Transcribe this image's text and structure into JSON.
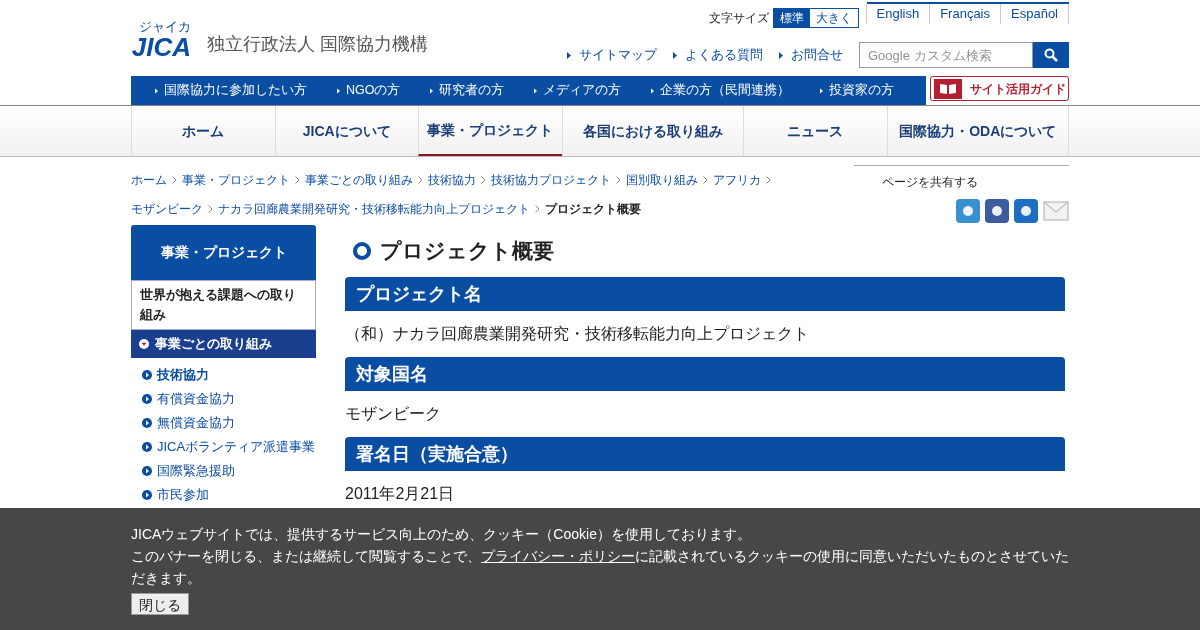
{
  "header": {
    "org_name": "独立行政法人 国際協力機構",
    "logo_text": "JICA",
    "logo_sub": "ジャイカ",
    "font_size": {
      "label": "文字サイズ",
      "options": [
        {
          "label": "標準",
          "selected": true
        },
        {
          "label": "大きく",
          "selected": false
        }
      ]
    },
    "languages": [
      "English",
      "Français",
      "Español"
    ],
    "links": [
      "サイトマップ",
      "よくある質問",
      "お問合せ"
    ],
    "search": {
      "placeholder": "Google カスタム検索"
    }
  },
  "audience_bar": {
    "links": [
      "国際協力に参加したい方",
      "NGOの方",
      "研究者の方",
      "メディアの方",
      "企業の方（民間連携）",
      "投資家の方"
    ],
    "guide": "サイト活用ガイド"
  },
  "nav": [
    {
      "label": "ホーム",
      "selected": false
    },
    {
      "label": "JICAについて",
      "selected": false
    },
    {
      "label": "事業・プロジェクト",
      "selected": true
    },
    {
      "label": "各国における取り組み",
      "selected": false
    },
    {
      "label": "ニュース",
      "selected": false
    },
    {
      "label": "国際協力・ODAについて",
      "selected": false
    }
  ],
  "breadcrumb": {
    "links": [
      "ホーム",
      "事業・プロジェクト",
      "事業ごとの取り組み",
      "技術協力",
      "技術協力プロジェクト",
      "国別取り組み",
      "アフリカ",
      "モザンビーク",
      "ナカラ回廊農業開発研究・技術移転能力向上プロジェクト"
    ],
    "current": "プロジェクト概要"
  },
  "share": {
    "label": "ページを共有する"
  },
  "sidebar": {
    "title": "事業・プロジェクト",
    "groups": [
      {
        "label": "世界が抱える課題への取り組み",
        "expanded": false
      },
      {
        "label": "事業ごとの取り組み",
        "expanded": true
      }
    ],
    "items": [
      {
        "label": "技術協力",
        "selected": true
      },
      {
        "label": "有償資金協力",
        "selected": false
      },
      {
        "label": "無償資金協力",
        "selected": false
      },
      {
        "label": "JICAボランティア派遣事業",
        "selected": false
      },
      {
        "label": "国際緊急援助",
        "selected": false
      },
      {
        "label": "市民参加",
        "selected": false
      }
    ]
  },
  "main": {
    "title": "プロジェクト概要",
    "sections": [
      {
        "heading": "プロジェクト名",
        "body": "（和）ナカラ回廊農業開発研究・技術移転能力向上プロジェクト"
      },
      {
        "heading": "対象国名",
        "body": "モザンビーク"
      },
      {
        "heading": "署名日（実施合意）",
        "body": "2011年2月21日"
      }
    ]
  },
  "cookie_banner": {
    "line1": "JICAウェブサイトでは、提供するサービス向上のため、クッキー（Cookie）を使用しております。",
    "line2_before": "このバナーを閉じる、または継続して閲覧することで、",
    "line2_link": "プライバシー・ポリシー",
    "line2_after": "に記載されているクッキーの使用に同意いただいたものとさせていただきます。",
    "close": "閉じる"
  }
}
